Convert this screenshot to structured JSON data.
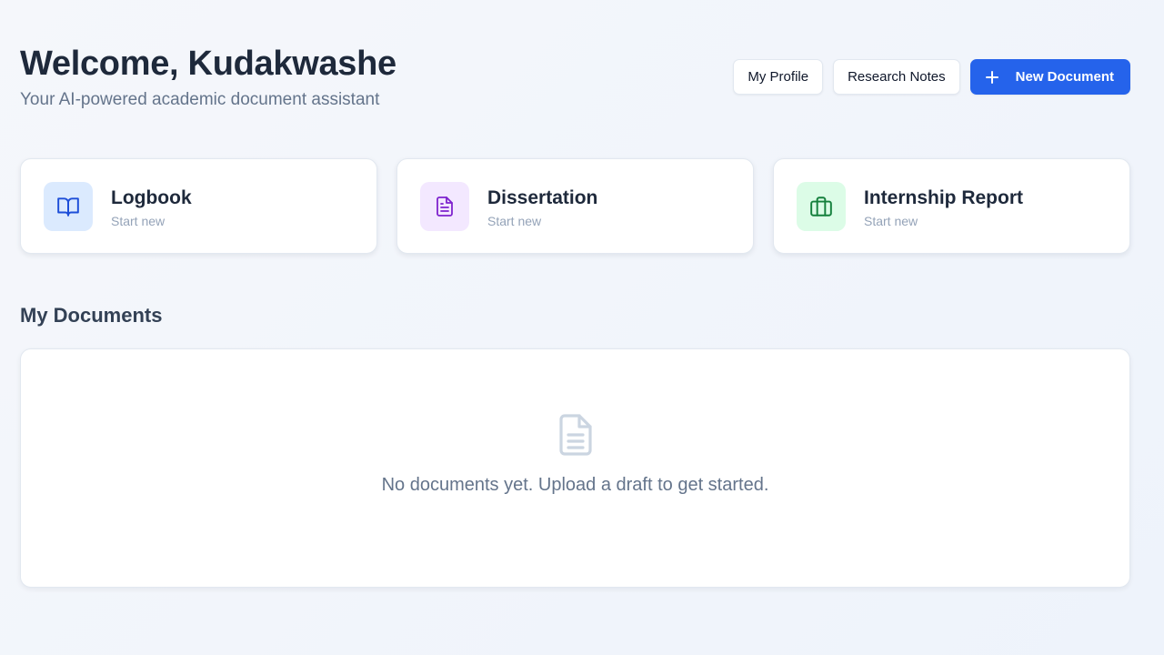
{
  "header": {
    "welcome": "Welcome, Kudakwashe",
    "subtitle": "Your AI-powered academic document assistant"
  },
  "actions": {
    "profile_label": "My Profile",
    "notes_label": "Research Notes",
    "new_document_label": "New Document"
  },
  "cards": [
    {
      "title": "Logbook",
      "subtitle": "Start new",
      "icon": "book-open-icon",
      "icon_bg": "#dbeafe",
      "icon_color": "#1d4ed8"
    },
    {
      "title": "Dissertation",
      "subtitle": "Start new",
      "icon": "file-text-icon",
      "icon_bg": "#f3e8ff",
      "icon_color": "#7e22ce"
    },
    {
      "title": "Internship Report",
      "subtitle": "Start new",
      "icon": "briefcase-icon",
      "icon_bg": "#dcfce7",
      "icon_color": "#15803d"
    }
  ],
  "documents": {
    "section_title": "My Documents",
    "empty_message": "No documents yet. Upload a draft to get started.",
    "empty_icon": "file-icon"
  },
  "colors": {
    "primary": "#2563eb",
    "text_dark": "#1e293b",
    "text_muted": "#64748b"
  }
}
